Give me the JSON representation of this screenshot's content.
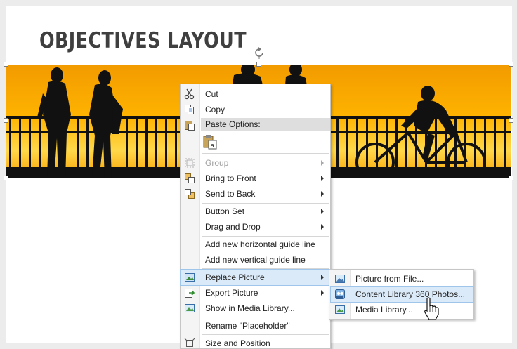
{
  "slide": {
    "title": "OBJECTIVES LAYOUT"
  },
  "context_menu": {
    "paste_options_header": "Paste Options:",
    "items": [
      {
        "key": "cut",
        "label": "Cut",
        "icon": "scissors-icon"
      },
      {
        "key": "copy",
        "label": "Copy",
        "icon": "copy-icon"
      },
      {
        "key": "group",
        "label": "Group",
        "icon": "group-icon",
        "disabled": true
      },
      {
        "key": "bring_to_front",
        "label": "Bring to Front",
        "icon": "bring-to-front-icon"
      },
      {
        "key": "send_to_back",
        "label": "Send to Back",
        "icon": "send-to-back-icon"
      },
      {
        "key": "button_set",
        "label": "Button Set"
      },
      {
        "key": "drag_and_drop",
        "label": "Drag and Drop"
      },
      {
        "key": "add_horizontal_guide",
        "label": "Add new horizontal guide line"
      },
      {
        "key": "add_vertical_guide",
        "label": "Add new vertical guide line"
      },
      {
        "key": "replace_picture",
        "label": "Replace Picture",
        "icon": "replace-picture-icon",
        "highlighted": true
      },
      {
        "key": "export_picture",
        "label": "Export Picture",
        "icon": "export-picture-icon"
      },
      {
        "key": "show_in_media_library",
        "label": "Show in Media Library...",
        "icon": "media-library-icon"
      },
      {
        "key": "rename",
        "label": "Rename \"Placeholder\""
      },
      {
        "key": "size_and_position",
        "label": "Size and Position",
        "icon": "size-position-icon"
      }
    ]
  },
  "submenu": {
    "items": [
      {
        "key": "picture_from_file",
        "label": "Picture from File...",
        "icon": "picture-file-icon"
      },
      {
        "key": "content_library",
        "label": "Content Library 360 Photos...",
        "icon": "content-library-icon",
        "highlighted": true
      },
      {
        "key": "media_library",
        "label": "Media Library...",
        "icon": "media-library-icon"
      }
    ]
  },
  "colors": {
    "highlight": "#dbeaf8",
    "sunset_top": "#f7a400",
    "sunset_mid": "#ffd23a",
    "silhouette": "#111111"
  }
}
